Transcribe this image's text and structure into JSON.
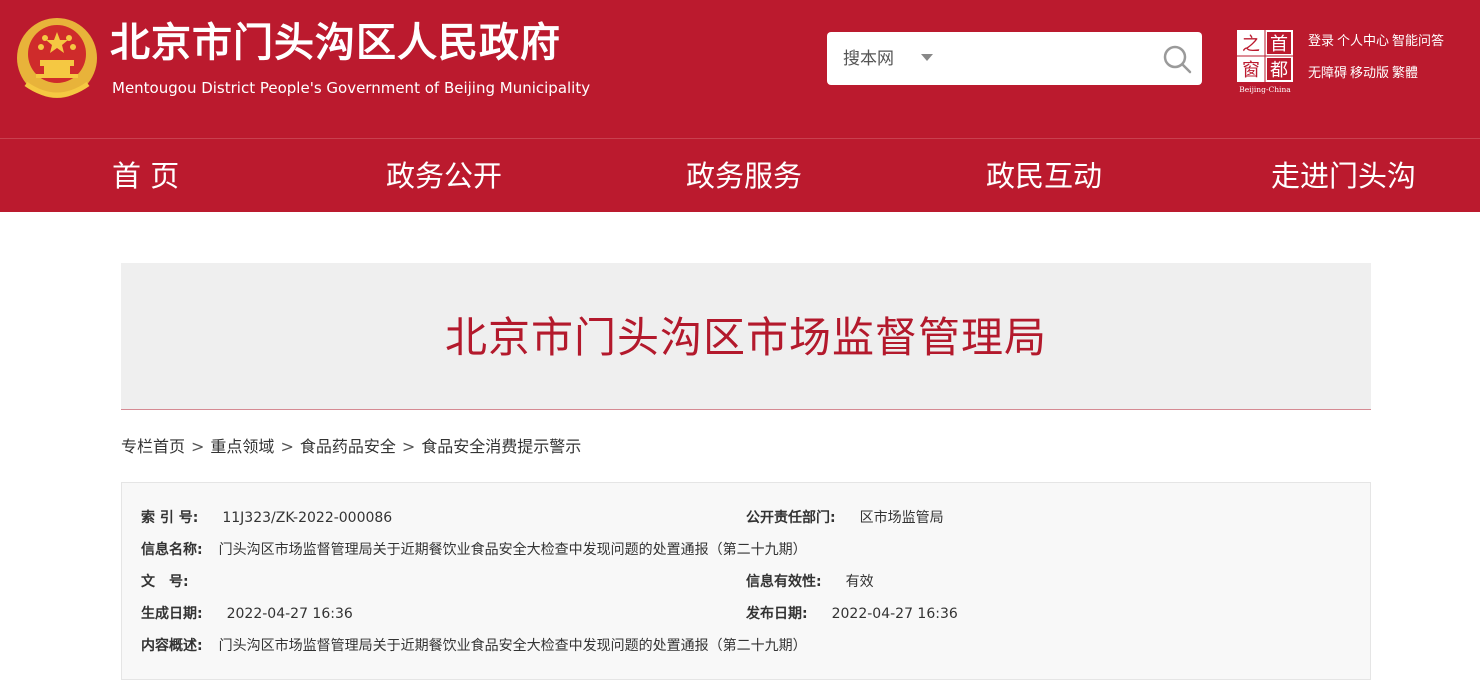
{
  "header": {
    "title": "北京市门头沟区人民政府",
    "subtitle": "Mentougou District People's Government of Beijing Municipality",
    "colors": {
      "brand_red": "#bb1a2e",
      "banner_title": "#b3192c",
      "banner_bg": "#efefef"
    }
  },
  "search": {
    "scope": "搜本网",
    "value": "",
    "placeholder": ""
  },
  "capital_logo": {
    "chars": [
      "之",
      "首",
      "窗",
      "都"
    ],
    "caption": "Beijing-China"
  },
  "top_links": {
    "row1": [
      "登录",
      "个人中心",
      "智能问答"
    ],
    "row2": [
      "无障碍",
      "移动版",
      "繁體"
    ]
  },
  "nav": {
    "items": [
      "首 页",
      "政务公开",
      "政务服务",
      "政民互动",
      "走进门头沟"
    ]
  },
  "banner": {
    "title": "北京市门头沟区市场监督管理局"
  },
  "breadcrumb": {
    "items": [
      "专栏首页",
      "重点领域",
      "食品药品安全",
      "食品安全消费提示警示"
    ],
    "separator": ">"
  },
  "info": {
    "index_label": "索 引 号:",
    "index_value": "11J323/ZK-2022-000086",
    "dept_label": "公开责任部门:",
    "dept_value": "区市场监管局",
    "name_label": "信息名称:",
    "name_value": "门头沟区市场监督管理局关于近期餐饮业食品安全大检查中发现问题的处置通报（第二十九期）",
    "docno_label": "文　号:",
    "docno_value": "",
    "validity_label": "信息有效性:",
    "validity_value": "有效",
    "created_label": "生成日期:",
    "created_value": "2022-04-27 16:36",
    "published_label": "发布日期:",
    "published_value": "2022-04-27 16:36",
    "summary_label": "内容概述:",
    "summary_value": "门头沟区市场监督管理局关于近期餐饮业食品安全大检查中发现问题的处置通报（第二十九期）"
  }
}
